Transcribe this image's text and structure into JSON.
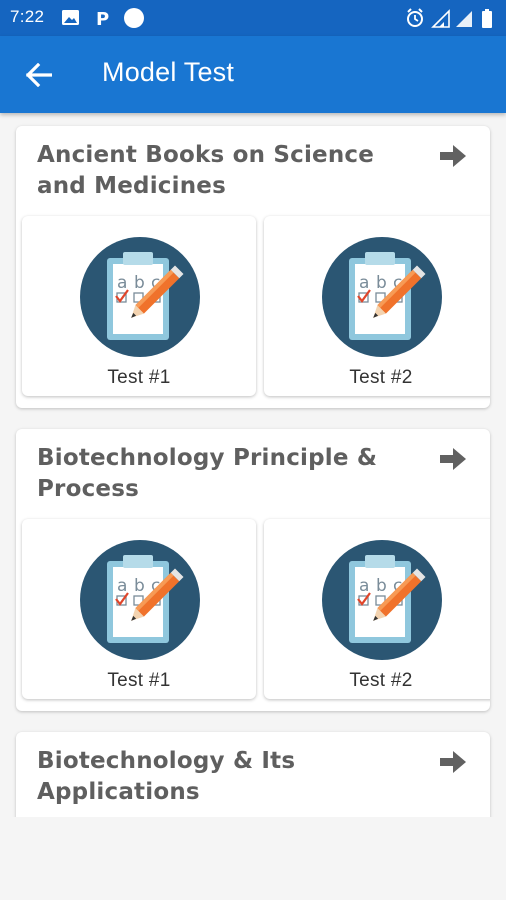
{
  "status_bar": {
    "time": "7:22",
    "left_icons": [
      "image-icon",
      "parking-icon",
      "circle-icon"
    ],
    "right_icons": [
      "alarm-icon",
      "signal-icon",
      "signal-icon",
      "battery-icon"
    ]
  },
  "app_bar": {
    "back_icon": "arrow-back-icon",
    "title": "Model Test"
  },
  "colors": {
    "status_bar": "#1565c0",
    "app_bar": "#1976d2",
    "icon_circle": "#2b5673",
    "pencil": "#f0722b"
  },
  "sections": [
    {
      "title": "Ancient Books on Science and Medicines",
      "arrow_icon": "arrow-right-icon",
      "tests": [
        {
          "label": "Test #1",
          "icon": "test-clipboard-icon"
        },
        {
          "label": "Test #2",
          "icon": "test-clipboard-icon"
        }
      ]
    },
    {
      "title": "Biotechnology Principle & Process",
      "arrow_icon": "arrow-right-icon",
      "tests": [
        {
          "label": "Test #1",
          "icon": "test-clipboard-icon"
        },
        {
          "label": "Test #2",
          "icon": "test-clipboard-icon"
        }
      ]
    },
    {
      "title": "Biotechnology & Its Applications",
      "arrow_icon": "arrow-right-icon",
      "tests": []
    }
  ]
}
